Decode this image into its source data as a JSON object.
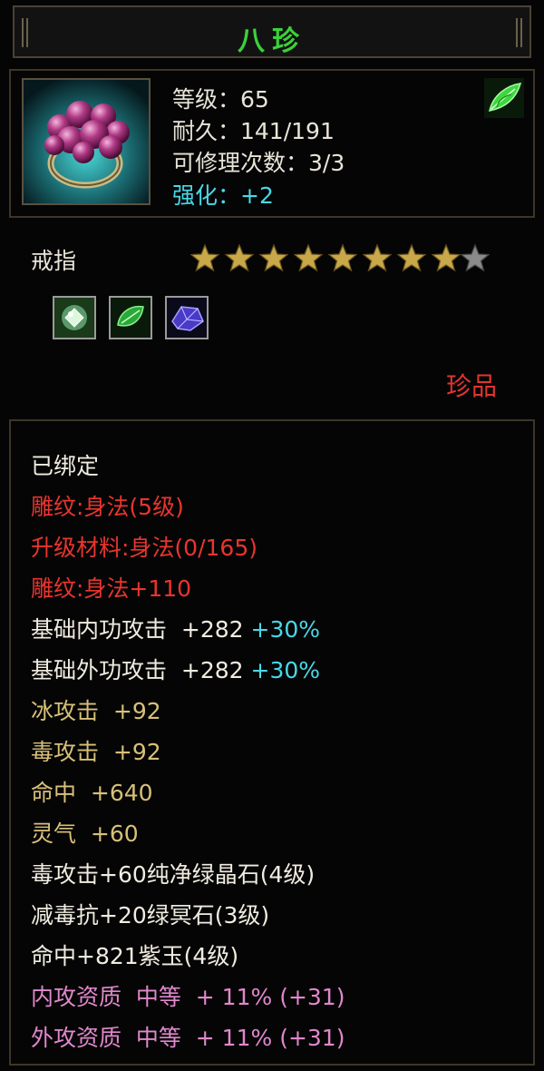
{
  "item": {
    "title": "八珍",
    "type": "戒指",
    "rarity": "珍品",
    "star_rating": {
      "filled": 8,
      "total": 9
    },
    "icon": "ring-icon",
    "category_icon": "green-leaf-icon",
    "colors": {
      "title": "#3ad13a",
      "red": "#e8352e",
      "gold": "#d8c078",
      "pink": "#e088cc",
      "cyan": "#48d8e8"
    }
  },
  "stats": {
    "level": "等级：65",
    "durability": "耐久：141/191",
    "repairs": "可修理次数：3/3",
    "enhance": "强化：+2"
  },
  "gems": [
    {
      "icon": "white-gem-icon"
    },
    {
      "icon": "green-gem-icon"
    },
    {
      "icon": "purple-gem-icon"
    }
  ],
  "details": {
    "bound": "已绑定",
    "engrave": "雕纹:身法(5级)",
    "upgrade": "升级材料:身法(0/165)",
    "engrave_bonus": "雕纹:身法+110",
    "inner_attack": "基础内功攻击  +282",
    "inner_attack_pct": "+30%",
    "outer_attack": "基础外功攻击  +282",
    "outer_attack_pct": "+30%",
    "ice_attack": "冰攻击  +92",
    "poison_attack": "毒攻击  +92",
    "hit": "命中  +640",
    "spirit": "灵气  +60",
    "gem1": "毒攻击+60纯净绿晶石(4级)",
    "gem2": "减毒抗+20绿冥石(3级)",
    "gem3": "命中+821紫玉(4级)",
    "inner_quality": "内攻资质  中等  + 11% (+31)",
    "outer_quality": "外攻资质  中等  + 11% (+31)"
  }
}
